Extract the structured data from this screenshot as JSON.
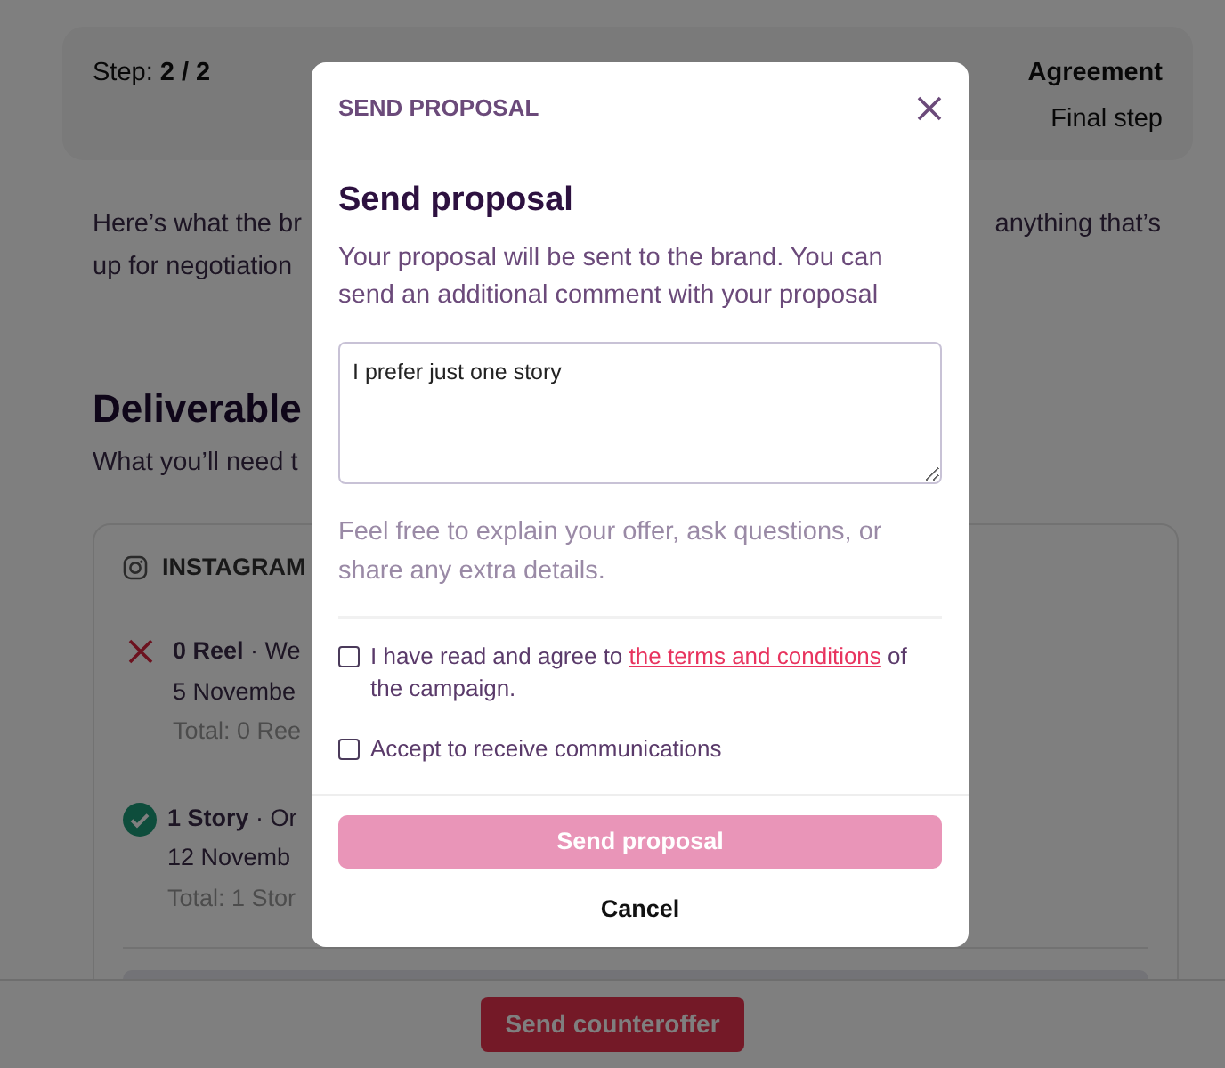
{
  "page": {
    "step_label": "Step:",
    "step_value": "2 / 2",
    "stage_title": "Agreement",
    "stage_subtitle": "Final step",
    "intro_left": [
      "Here’s what the br",
      "up for negotiation"
    ],
    "intro_right": "anything that’s",
    "deliverables_title": "Deliverable",
    "deliverables_subtitle": "What you’ll need t",
    "platform": "INSTAGRAM",
    "items": [
      {
        "accepted": false,
        "title": "**0 Reel** · We",
        "date": "5 Novembe",
        "total": "Total: 0 Ree"
      },
      {
        "accepted": true,
        "title": "**1 Story** · Or",
        "date": "12 Novemb",
        "total": "Total: 1 Stor"
      }
    ],
    "footer_button": "Send counteroffer"
  },
  "modal": {
    "header": "SEND PROPOSAL",
    "title": "Send proposal",
    "description": "Your proposal will be sent to the brand. You can send an additional comment with your proposal",
    "comment": "I prefer just one story",
    "hint": "Feel free to explain your offer, ask questions, or share any extra details.",
    "checkboxes": [
      {
        "kind": "terms",
        "text_before": "I have read and agree to ",
        "link": "the terms and conditions",
        "text_after": " of the campaign.",
        "checked": false
      },
      {
        "kind": "plain",
        "text": "Accept to receive communications",
        "checked": false
      }
    ],
    "submit": {
      "label": "Send proposal",
      "disabled": true
    },
    "cancel": "Cancel"
  }
}
